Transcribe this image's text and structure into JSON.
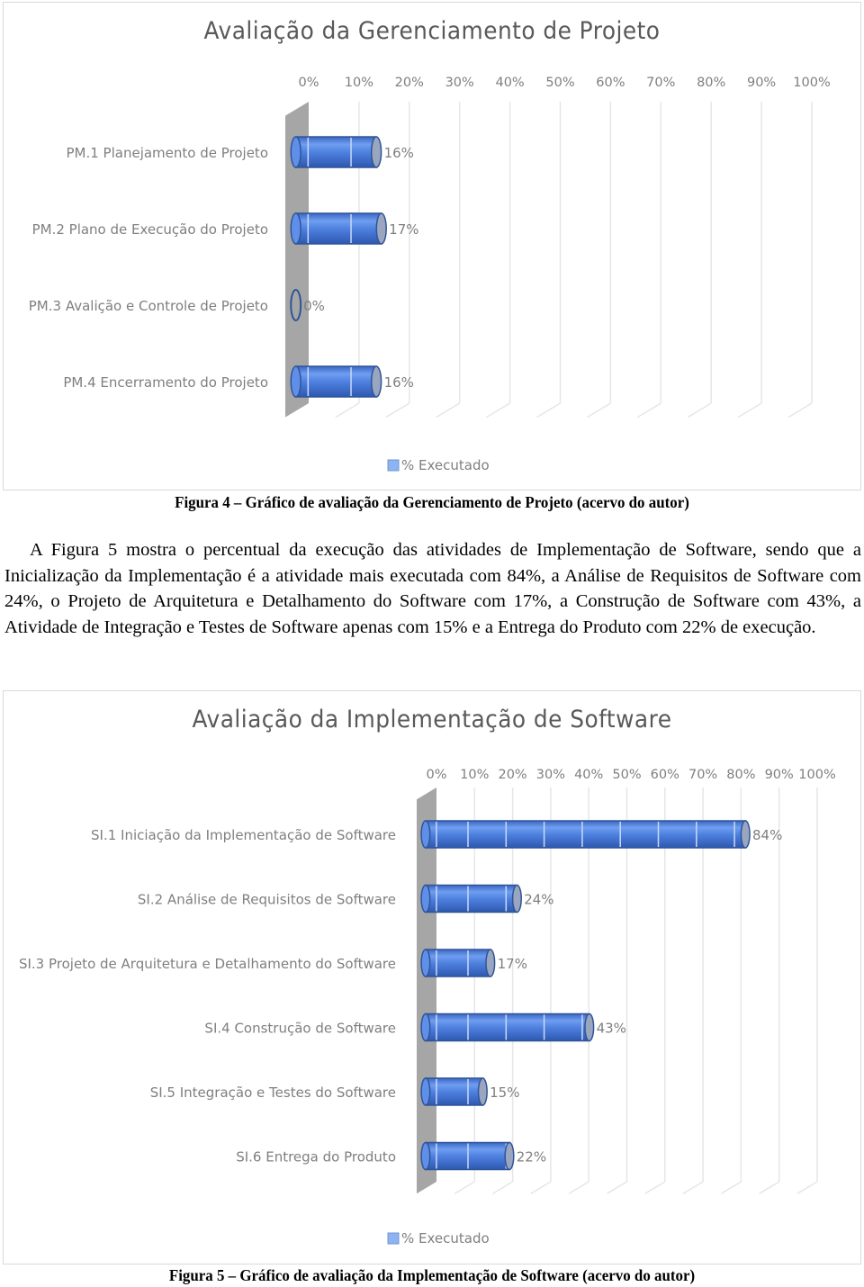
{
  "chart_data": [
    {
      "type": "bar",
      "orientation": "horizontal",
      "style": "3d-cylinder",
      "title": "Avaliação da Gerenciamento de Projeto",
      "categories": [
        "PM.1 Planejamento de Projeto",
        "PM.2 Plano de Execução do Projeto",
        "PM.3 Avalição e Controle de Projeto",
        "PM.4 Encerramento do Projeto"
      ],
      "series": [
        {
          "name": "% Executado",
          "values": [
            16,
            17,
            0,
            16
          ],
          "color": "#4f81e0"
        }
      ],
      "data_labels": [
        "16%",
        "17%",
        "0%",
        "16%"
      ],
      "x_ticks": [
        "0%",
        "10%",
        "20%",
        "30%",
        "40%",
        "50%",
        "60%",
        "70%",
        "80%",
        "90%",
        "100%"
      ],
      "xlim": [
        0,
        100
      ],
      "xlabel": "",
      "ylabel": "",
      "grid": true,
      "legend": "bottom",
      "legend_label": "% Executado"
    },
    {
      "type": "bar",
      "orientation": "horizontal",
      "style": "3d-cylinder",
      "title": "Avaliação da Implementação de Software",
      "categories": [
        "SI.1 Iniciação da Implementação de Software",
        "SI.2 Análise de Requisitos de Software",
        "SI.3 Projeto de Arquitetura e Detalhamento do Software",
        "SI.4 Construção de Software",
        "SI.5 Integração e Testes do Software",
        "SI.6 Entrega do Produto"
      ],
      "series": [
        {
          "name": "% Executado",
          "values": [
            84,
            24,
            17,
            43,
            15,
            22
          ],
          "color": "#4f81e0"
        }
      ],
      "data_labels": [
        "84%",
        "24%",
        "17%",
        "43%",
        "15%",
        "22%"
      ],
      "x_ticks": [
        "0%",
        "10%",
        "20%",
        "30%",
        "40%",
        "50%",
        "60%",
        "70%",
        "80%",
        "90%",
        "100%"
      ],
      "xlim": [
        0,
        100
      ],
      "xlabel": "",
      "ylabel": "",
      "grid": true,
      "legend": "bottom",
      "legend_label": "% Executado"
    }
  ],
  "captions": {
    "figure4": "Figura 4 – Gráfico de avaliação da Gerenciamento de Projeto (acervo do autor)",
    "figure5": "Figura 5 – Gráfico de avaliação da Implementação de Software (acervo do autor)"
  },
  "paragraph": "A Figura 5 mostra o percentual da execução das atividades de Implementação de Software, sendo que a Inicialização da Implementação é a atividade mais executada com 84%, a Análise de Requisitos de Software com 24%, o Projeto de Arquitetura e Detalhamento do Software com 17%, a Construção de Software com 43%, a Atividade de Integração e Testes de Software apenas com 15% e a Entrega do Produto com 22% de execução.",
  "colors": {
    "bar": "#4f81e0",
    "bar_dark": "#2f5597",
    "wall": "#a6a6a6",
    "grid": "#e6e6e6",
    "text": "#7f7f7f",
    "legend_swatch": "#8db3f0"
  }
}
